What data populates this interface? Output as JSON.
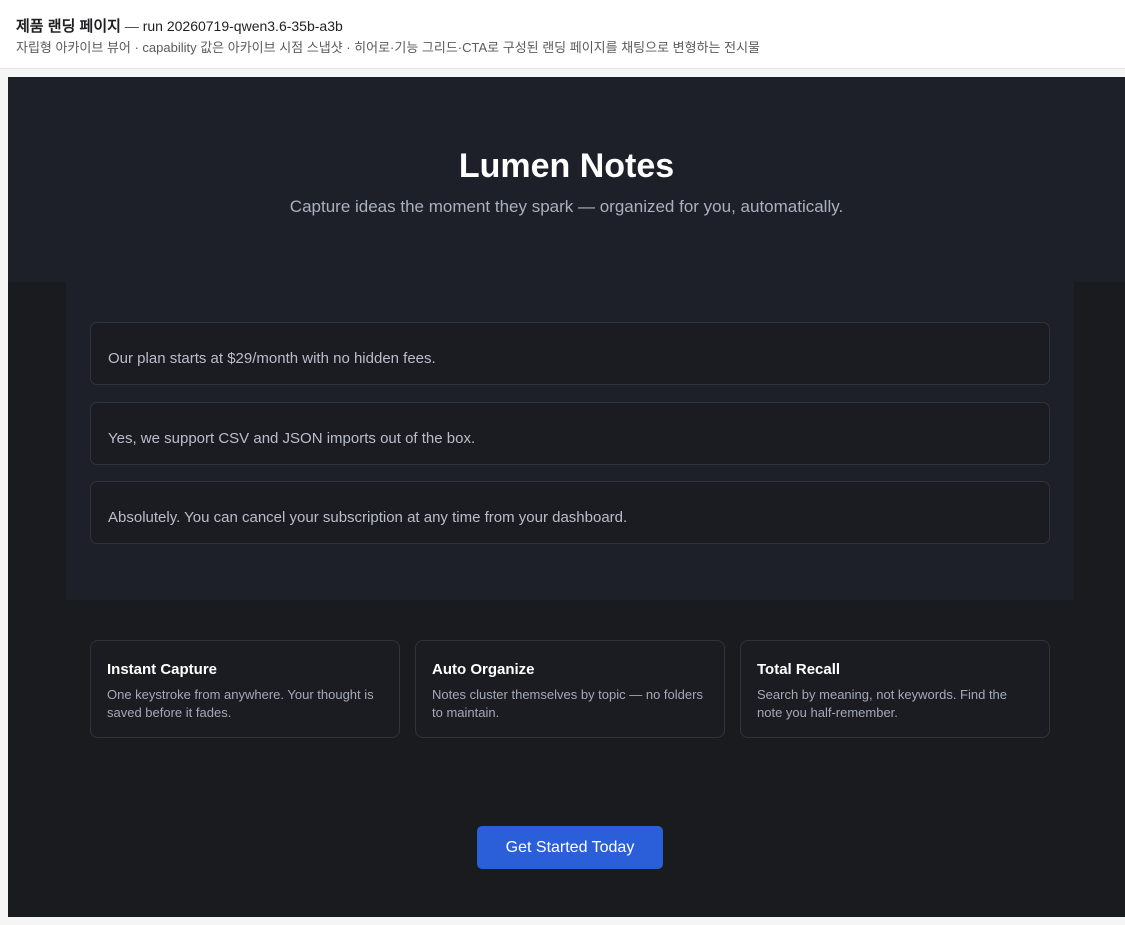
{
  "header": {
    "title": "제품 랜딩 페이지",
    "separator": "—",
    "run": "run 20260719-qwen3.6-35b-a3b",
    "subtitle": "자립형 아카이브 뷰어 · capability 값은 아카이브 시점 스냅샷 · 히어로·기능 그리드·CTA로 구성된 랜딩 페이지를 채팅으로 변형하는 전시물"
  },
  "hero": {
    "title": "Lumen Notes",
    "tagline": "Capture ideas the moment they spark — organized for you, automatically."
  },
  "faq": [
    {
      "answer": "Our plan starts at $29/month with no hidden fees."
    },
    {
      "answer": "Yes, we support CSV and JSON imports out of the box."
    },
    {
      "answer": "Absolutely. You can cancel your subscription at any time from your dashboard."
    }
  ],
  "features": [
    {
      "title": "Instant Capture",
      "desc": "One keystroke from anywhere. Your thought is saved before it fades."
    },
    {
      "title": "Auto Organize",
      "desc": "Notes cluster themselves by topic — no folders to maintain."
    },
    {
      "title": "Total Recall",
      "desc": "Search by meaning, not keywords. Find the note you half-remember."
    }
  ],
  "cta": {
    "label": "Get Started Today"
  },
  "colors": {
    "background": "#1a1b1f",
    "panel": "#1d2029",
    "card_border": "#30333b",
    "accent": "#2b5fd9"
  }
}
